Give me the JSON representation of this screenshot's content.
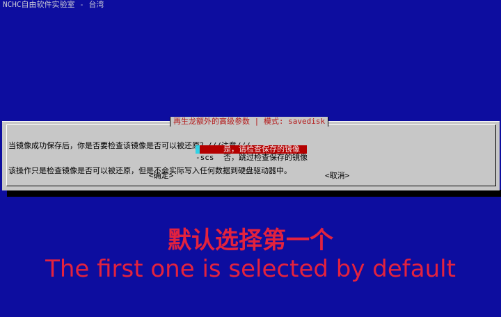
{
  "window": {
    "title": "NCHC自由软件实验室 - 台湾"
  },
  "dialog": {
    "title": "再生龙额外的高级参数 | 模式: savedisk",
    "message_lines": [
      "当镜像成功保存后，你是否要检查该镜像是否可以被还原？///注意///",
      "该操作只是检查镜像是否可以被还原，但是不会实际写入任何数据到硬盘驱动器中。"
    ],
    "options": [
      {
        "tag": "",
        "label": "是，请检查保存的镜像",
        "selected": true
      },
      {
        "tag": "-scs",
        "label": "否，跳过检查保存的镜像",
        "selected": false
      }
    ],
    "ok_label": "<确定>",
    "cancel_label": "<取消>"
  },
  "caption": {
    "chinese": "默认选择第一个",
    "english": "The first one is selected by default"
  },
  "colors": {
    "background": "#0d0d9f",
    "dialog": "#c7c7c7",
    "title_text": "#b41818",
    "selection": "#b40000",
    "caption": "#e3223e"
  }
}
